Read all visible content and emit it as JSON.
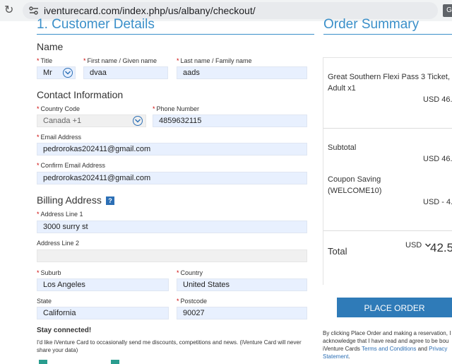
{
  "browser": {
    "url": "iventurecard.com/index.php/us/albany/checkout/",
    "translate_glyph": "G"
  },
  "customer": {
    "section_title": "1. Customer Details",
    "name_heading": "Name",
    "title_label": "Title",
    "title_value": "Mr",
    "first_label": "First name / Given name",
    "first_value": "dvaa",
    "last_label": "Last name / Family name",
    "last_value": "aads",
    "contact_heading": "Contact Information",
    "country_code_label": "Country Code",
    "country_code_value": "Canada +1",
    "phone_label": "Phone Number",
    "phone_value": "4859632115",
    "email_label": "Email Address",
    "email_value": "pedrorokas202411@gmail.com",
    "confirm_email_label": "Confirm Email Address",
    "confirm_email_value": "pedrorokas202411@gmail.com",
    "billing_heading": "Billing Address",
    "billing_help": "?",
    "addr1_label": "Address Line 1",
    "addr1_value": "3000 surry st",
    "addr2_label": "Address Line 2",
    "addr2_value": "",
    "suburb_label": "Suburb",
    "suburb_value": "Los Angeles",
    "country_label": "Country",
    "country_value": "United States",
    "state_label": "State",
    "state_value": "California",
    "postcode_label": "Postcode",
    "postcode_value": "90027",
    "stay_heading": "Stay connected!",
    "stay_text_1": "I'd like iVenture Card to occasionally send me discounts, competitions and news. (iVenture Card will never",
    "stay_text_2": "share your data)"
  },
  "summary": {
    "section_title": "Order Summary",
    "item_line1": "Great Southern Flexi Pass 3 Ticket,",
    "item_line2": "Adult x1",
    "item_price": "USD 46.",
    "subtotal_label": "Subtotal",
    "subtotal_value": "USD 46.",
    "coupon_label": "Coupon Saving",
    "coupon_code": "(WELCOME10)",
    "coupon_value": "USD - 4.",
    "total_label": "Total",
    "total_currency": "USD",
    "total_value": "42.5",
    "place_order": "PLACE ORDER",
    "legal_1": "By clicking Place Order and making a reservation, I",
    "legal_2": "acknowledge that I have read and agree to be bou",
    "legal_3a": "iVenture Cards ",
    "legal_link1": "Terms and Conditions",
    "legal_3b": " and ",
    "legal_link2": "Privacy",
    "legal_link3": "Statement",
    "legal_4": "."
  }
}
